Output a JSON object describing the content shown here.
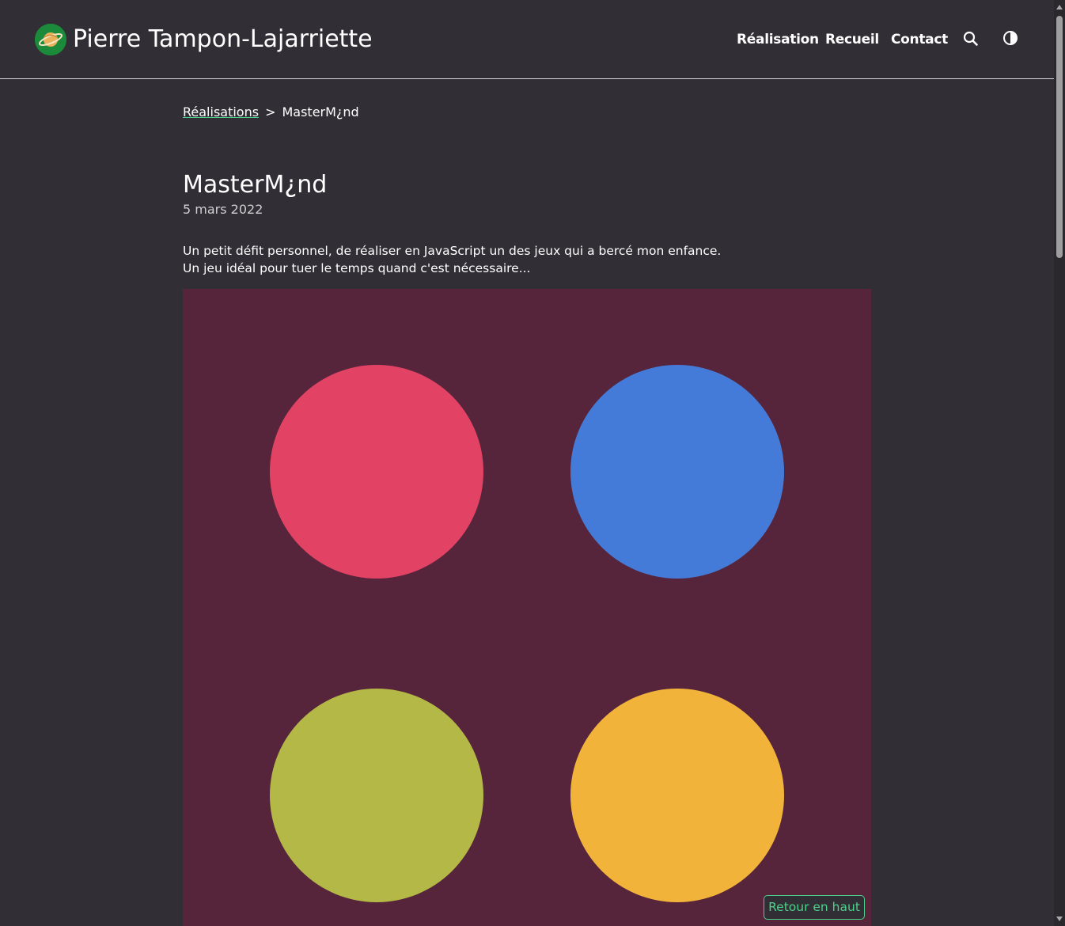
{
  "header": {
    "site_title": "Pierre Tampon-Lajarriette",
    "nav": {
      "realisation": "Réalisation",
      "recueil": "Recueil",
      "contact": "Contact"
    },
    "icons": [
      "planet-logo-icon",
      "search-icon",
      "theme-toggle-icon"
    ]
  },
  "breadcrumb": {
    "parent": "Réalisations",
    "separator": ">",
    "current": "MasterM¿nd"
  },
  "article": {
    "title": "MasterM¿nd",
    "date": "5 mars 2022",
    "intro_line_1": "Un petit défit personnel, de réaliser en JavaScript un des jeux qui a bercé mon enfance.",
    "intro_line_2": "Un jeu idéal pour tuer le temps quand c'est nécessaire..."
  },
  "game": {
    "board_color": "#56243b",
    "pegs": [
      {
        "color_name": "red",
        "color": "#e24264"
      },
      {
        "color_name": "blue",
        "color": "#457bd8"
      },
      {
        "color_name": "olive",
        "color": "#b3b846"
      },
      {
        "color_name": "orange",
        "color": "#f2b33b"
      }
    ]
  },
  "back_to_top": "Retour en haut",
  "colors": {
    "background": "#322e35",
    "accent": "#4cd28a",
    "logo_bg": "#1b8a3a"
  }
}
